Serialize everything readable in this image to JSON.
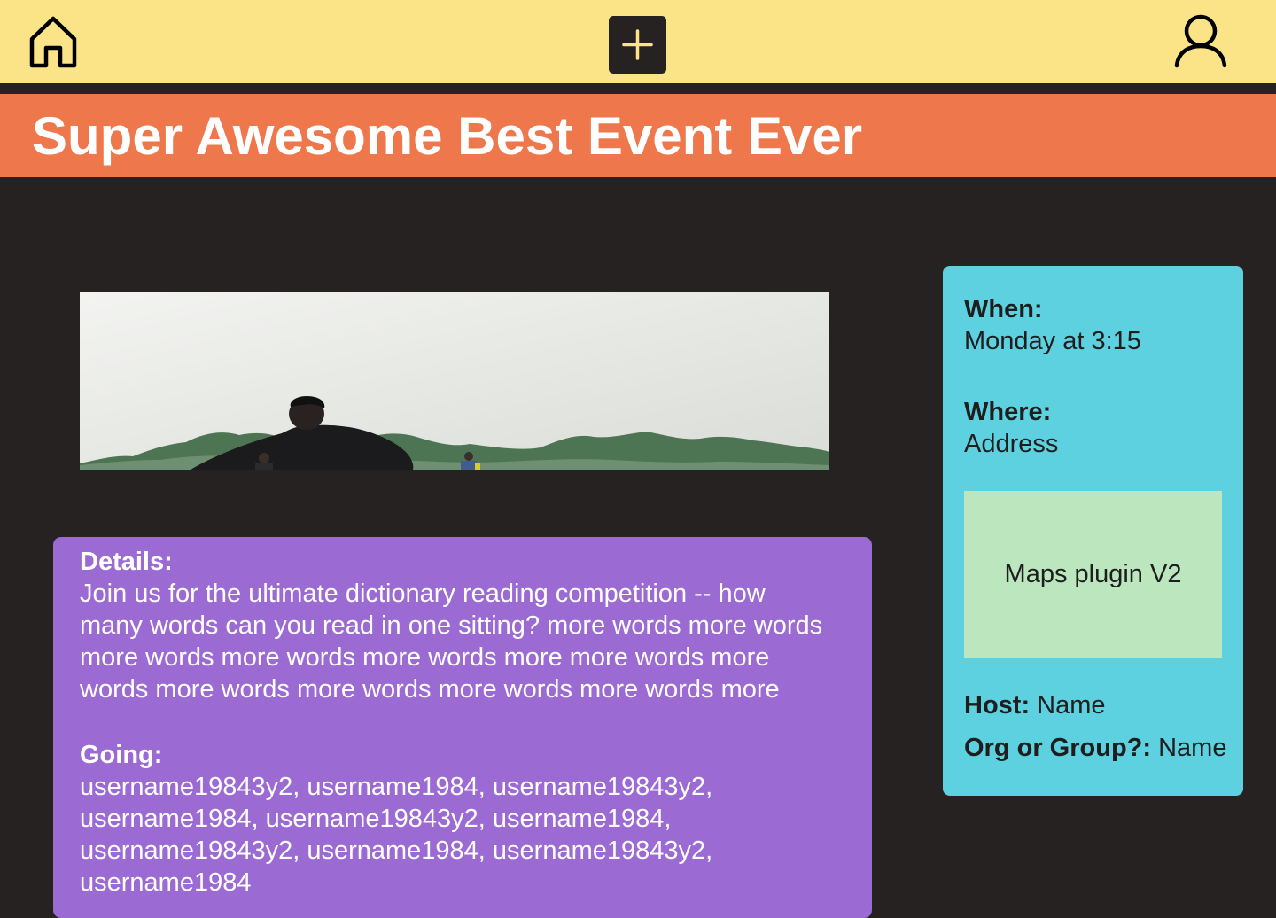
{
  "nav": {
    "home_icon": "home-icon",
    "add_icon": "plus-icon",
    "profile_icon": "user-icon"
  },
  "event": {
    "title": "Super Awesome Best Event Ever",
    "photo_description": "event-photo"
  },
  "details": {
    "label": "Details:",
    "text": "Join us for the ultimate dictionary reading competition -- how many words can you read in one sitting? more words more words more words more words more words more more words more words more words more words more words more words more",
    "going_label": "Going:",
    "attendees": "username19843y2, username1984, username19843y2, username1984, username19843y2, username1984, username19843y2, username1984, username19843y2, username1984"
  },
  "info": {
    "when_label": "When:",
    "when_value": "Monday at 3:15",
    "where_label": "Where:",
    "where_value": "Address",
    "map_label": "Maps plugin V2",
    "host_label": "Host:",
    "host_value": "Name",
    "org_label": "Org or Group?:",
    "org_value": "Name"
  },
  "colors": {
    "topbar": "#FBE488",
    "banner": "#EE774C",
    "background": "#262222",
    "details_card": "#9B6BD3",
    "info_card": "#5DD1DF",
    "map_box": "#BCE6BE"
  }
}
